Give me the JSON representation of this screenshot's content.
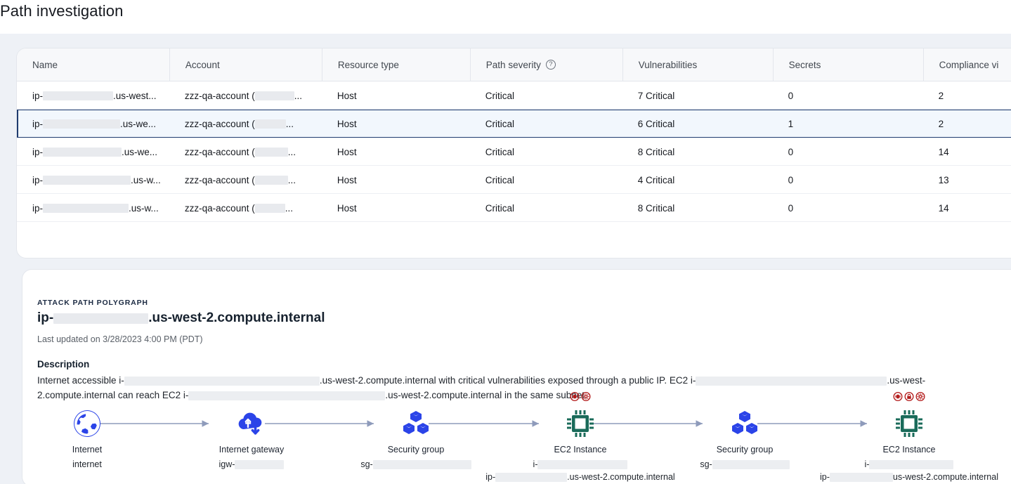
{
  "page": {
    "title": "Path investigation"
  },
  "table": {
    "columns": [
      {
        "label": "Name",
        "has_hint": false
      },
      {
        "label": "Account",
        "has_hint": false
      },
      {
        "label": "Resource type",
        "has_hint": false
      },
      {
        "label": "Path severity",
        "has_hint": true,
        "hint_icon": "question-circle-icon"
      },
      {
        "label": "Vulnerabilities",
        "has_hint": false
      },
      {
        "label": "Secrets",
        "has_hint": false
      },
      {
        "label": "Compliance vi",
        "has_hint": false,
        "truncated": true
      }
    ],
    "rows": [
      {
        "name_prefix": "ip-",
        "name_suffix": ".us-west...",
        "name_redacted_width": 100,
        "account_prefix": "zzz-qa-account (",
        "account_suffix": "...",
        "account_redacted_width": 56,
        "resource_type": "Host",
        "path_severity": "Critical",
        "vulnerabilities": "7 Critical",
        "secrets": "0",
        "compliance": "2",
        "selected": false
      },
      {
        "name_prefix": "ip-",
        "name_suffix": ".us-we...",
        "name_redacted_width": 110,
        "account_prefix": "zzz-qa-account (",
        "account_suffix": "...",
        "account_redacted_width": 44,
        "resource_type": "Host",
        "path_severity": "Critical",
        "vulnerabilities": "6 Critical",
        "secrets": "1",
        "compliance": "2",
        "selected": true
      },
      {
        "name_prefix": "ip-",
        "name_suffix": ".us-we...",
        "name_redacted_width": 112,
        "account_prefix": "zzz-qa-account (",
        "account_suffix": "...",
        "account_redacted_width": 47,
        "resource_type": "Host",
        "path_severity": "Critical",
        "vulnerabilities": "8 Critical",
        "secrets": "0",
        "compliance": "14",
        "selected": false
      },
      {
        "name_prefix": "ip-",
        "name_suffix": ".us-w...",
        "name_redacted_width": 125,
        "account_prefix": "zzz-qa-account (",
        "account_suffix": "...",
        "account_redacted_width": 47,
        "resource_type": "Host",
        "path_severity": "Critical",
        "vulnerabilities": "4 Critical",
        "secrets": "0",
        "compliance": "13",
        "selected": false
      },
      {
        "name_prefix": "ip-",
        "name_suffix": ".us-w...",
        "name_redacted_width": 122,
        "account_prefix": "zzz-qa-account (",
        "account_suffix": "...",
        "account_redacted_width": 43,
        "resource_type": "Host",
        "path_severity": "Critical",
        "vulnerabilities": "8 Critical",
        "secrets": "0",
        "compliance": "14",
        "selected": false
      }
    ]
  },
  "detail": {
    "eyebrow": "ATTACK PATH POLYGRAPH",
    "title_prefix": "ip-",
    "title_suffix": ".us-west-2.compute.internal",
    "title_redacted_width": 135,
    "updated": "Last updated on 3/28/2023 4:00 PM (PDT)",
    "description_heading": "Description",
    "description_line1_a": "Internet accessible i-",
    "description_line1_b": ".us-west-2.compute.internal with critical vulnerabilities exposed through a public IP. EC2 i-",
    "description_line1_c": ".us-west-",
    "description_line2_a": "2.compute.internal can reach EC2 i-",
    "description_line2_b": ".us-west-2.compute.internal in the same subnet."
  },
  "graph": {
    "nodes": [
      {
        "label": "Internet",
        "icon": "globe-icon",
        "sub1_prefix": "internet",
        "sub1_redacted_width": 0,
        "sub1_suffix": "",
        "sub2": null,
        "badges": []
      },
      {
        "label": "Internet gateway",
        "icon": "internet-gateway-icon",
        "sub1_prefix": "igw-",
        "sub1_redacted_width": 70,
        "sub1_suffix": "",
        "sub2": null,
        "badges": []
      },
      {
        "label": "Security group",
        "icon": "security-group-icon",
        "sub1_prefix": "sg-",
        "sub1_redacted_width": 140,
        "sub1_suffix": "",
        "sub2": null,
        "badges": []
      },
      {
        "label": "EC2 Instance",
        "icon": "ec2-instance-icon",
        "sub1_prefix": "i-",
        "sub1_redacted_width": 128,
        "sub1_suffix": "",
        "sub2_prefix": "ip-",
        "sub2_redacted_width": 102,
        "sub2_suffix": ".us-west-2.compute.internal",
        "badges": [
          "vulnerability-badge",
          "compliance-badge"
        ]
      },
      {
        "label": "Security group",
        "icon": "security-group-icon",
        "sub1_prefix": "sg-",
        "sub1_redacted_width": 110,
        "sub1_suffix": "",
        "sub2": null,
        "badges": []
      },
      {
        "label": "EC2 Instance",
        "icon": "ec2-instance-icon",
        "sub1_prefix": "i-",
        "sub1_redacted_width": 120,
        "sub1_suffix": "",
        "sub2_prefix": "ip-",
        "sub2_redacted_width": 90,
        "sub2_suffix": "us-west-2.compute.internal",
        "badges": [
          "vulnerability-badge",
          "secret-badge",
          "compliance-badge"
        ]
      }
    ]
  },
  "colors": {
    "accent_blue": "#2b44e8",
    "ec2_green": "#1a6b5a",
    "badge_red": "#b31b1b",
    "selected_border": "#1f3b6e",
    "selected_fill": "#f2f7fd",
    "page_bg": "#eef1f6",
    "edge": "#8e9bbb"
  }
}
